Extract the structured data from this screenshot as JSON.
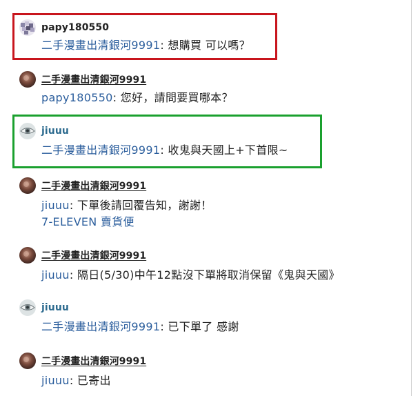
{
  "colors": {
    "mention": "#2a5d9c",
    "text": "#222222",
    "highlight_red": "#c8151d",
    "highlight_green": "#1aa02e"
  },
  "messages": [
    {
      "sender": "papy180550",
      "mention": "二手漫畫出清銀河9991",
      "sep": ": ",
      "text": "想購買 可以嗎？",
      "avatar_icon": "mosaic-avatar-icon"
    },
    {
      "sender": "二手漫畫出清銀河9991",
      "mention": "papy180550",
      "sep": ": ",
      "text": "您好，請問要買哪本？",
      "avatar_icon": "photo-avatar-icon"
    },
    {
      "sender": "jiuuu",
      "mention": "二手漫畫出清銀河9991",
      "sep": ": ",
      "text": "收鬼與天國上+下首限~",
      "avatar_icon": "eye-avatar-icon"
    },
    {
      "sender": "二手漫畫出清銀河9991",
      "mention": "jiuuu",
      "sep": ": ",
      "text": "下單後請回覆告知，謝謝！",
      "extra_line": "7-ELEVEN 賣貨便",
      "avatar_icon": "photo-avatar-icon"
    },
    {
      "sender": "二手漫畫出清銀河9991",
      "mention": "jiuuu",
      "sep": ": ",
      "text": "隔日(5/30)中午12點沒下單將取消保留《鬼與天國》",
      "avatar_icon": "photo-avatar-icon"
    },
    {
      "sender": "jiuuu",
      "mention": "二手漫畫出清銀河9991",
      "sep": ": ",
      "text": "已下單了 感謝",
      "avatar_icon": "eye-avatar-icon"
    },
    {
      "sender": "二手漫畫出清銀河9991",
      "mention": "jiuuu",
      "sep": ": ",
      "text": "已寄出",
      "avatar_icon": "photo-avatar-icon"
    }
  ]
}
